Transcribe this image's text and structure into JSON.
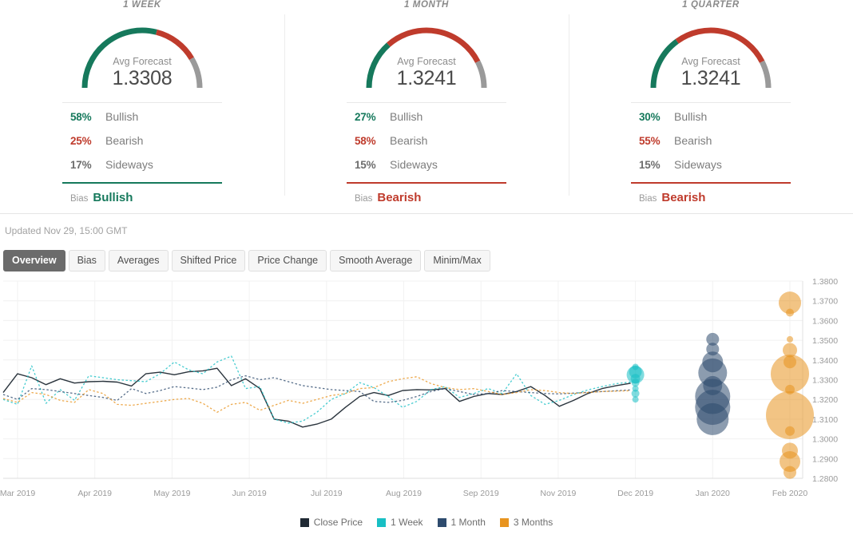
{
  "panels": [
    {
      "title": "1 WEEK",
      "gauge_label": "Avg Forecast",
      "gauge_value": "1.3308",
      "bullish_pct": "58%",
      "bullish_label": "Bullish",
      "bearish_pct": "25%",
      "bearish_label": "Bearish",
      "sideways_pct": "17%",
      "sideways_label": "Sideways",
      "bias_label": "Bias",
      "bias_value": "Bullish",
      "bias_color": "#16795c",
      "arc": {
        "green": 58,
        "red": 25,
        "gray": 17
      }
    },
    {
      "title": "1 MONTH",
      "gauge_label": "Avg Forecast",
      "gauge_value": "1.3241",
      "bullish_pct": "27%",
      "bullish_label": "Bullish",
      "bearish_pct": "58%",
      "bearish_label": "Bearish",
      "sideways_pct": "15%",
      "sideways_label": "Sideways",
      "bias_label": "Bias",
      "bias_value": "Bearish",
      "bias_color": "#bf3b2c",
      "arc": {
        "green": 27,
        "red": 58,
        "gray": 15
      }
    },
    {
      "title": "1 QUARTER",
      "gauge_label": "Avg Forecast",
      "gauge_value": "1.3241",
      "bullish_pct": "30%",
      "bullish_label": "Bullish",
      "bearish_pct": "55%",
      "bearish_label": "Bearish",
      "sideways_pct": "15%",
      "sideways_label": "Sideways",
      "bias_label": "Bias",
      "bias_value": "Bearish",
      "bias_color": "#bf3b2c",
      "arc": {
        "green": 30,
        "red": 55,
        "gray": 15
      }
    }
  ],
  "updated": "Updated Nov 29, 15:00 GMT",
  "tabs": [
    {
      "label": "Overview",
      "active": true
    },
    {
      "label": "Bias",
      "active": false
    },
    {
      "label": "Averages",
      "active": false
    },
    {
      "label": "Shifted Price",
      "active": false
    },
    {
      "label": "Price Change",
      "active": false
    },
    {
      "label": "Smooth Average",
      "active": false
    },
    {
      "label": "Minim/Max",
      "active": false
    }
  ],
  "colors": {
    "bullish": "#16795c",
    "bearish": "#bf3b2c",
    "neutral": "#9a9a9a",
    "close_price": "#1f2933",
    "one_week": "#18bfc4",
    "one_month": "#2e4b6e",
    "three_months": "#e8941f"
  },
  "chart_data": {
    "type": "line",
    "title": "",
    "xlabel": "",
    "ylabel": "",
    "ylim": [
      1.28,
      1.38
    ],
    "grid": true,
    "legend_position": "bottom",
    "y_ticks": [
      "1.3800",
      "1.3700",
      "1.3600",
      "1.3500",
      "1.3400",
      "1.3300",
      "1.3200",
      "1.3100",
      "1.3000",
      "1.2900",
      "1.2800"
    ],
    "x_ticks": [
      "Mar 2019",
      "Apr 2019",
      "May 2019",
      "Jun 2019",
      "Jul 2019",
      "Aug 2019",
      "Sep 2019",
      "Nov 2019",
      "Dec 2019",
      "Jan 2020",
      "Feb 2020"
    ],
    "legend": [
      {
        "name": "Close Price",
        "color": "#1f2933"
      },
      {
        "name": "1 Week",
        "color": "#18bfc4"
      },
      {
        "name": "1 Month",
        "color": "#2e4b6e"
      },
      {
        "name": "3 Months",
        "color": "#e8941f"
      }
    ],
    "series": [
      {
        "name": "Close Price",
        "color": "#1f2933",
        "style": "solid",
        "values": [
          1.3235,
          1.333,
          1.331,
          1.3275,
          1.3305,
          1.3283,
          1.329,
          1.3292,
          1.3288,
          1.3268,
          1.333,
          1.3338,
          1.3325,
          1.334,
          1.3345,
          1.3358,
          1.327,
          1.3305,
          1.3255,
          1.31,
          1.309,
          1.306,
          1.3075,
          1.31,
          1.316,
          1.3215,
          1.3235,
          1.322,
          1.3245,
          1.325,
          1.3248,
          1.3255,
          1.319,
          1.3215,
          1.323,
          1.3225,
          1.324,
          1.3265,
          1.322,
          1.3165,
          1.3195,
          1.323,
          1.3255,
          1.327,
          1.3282
        ]
      },
      {
        "name": "1 Week",
        "color": "#18bfc4",
        "style": "dotted",
        "values": [
          1.32,
          1.3175,
          1.337,
          1.318,
          1.325,
          1.3195,
          1.332,
          1.331,
          1.33,
          1.3295,
          1.329,
          1.333,
          1.339,
          1.335,
          1.333,
          1.339,
          1.342,
          1.3255,
          1.3265,
          1.31,
          1.308,
          1.309,
          1.3135,
          1.32,
          1.323,
          1.3285,
          1.326,
          1.3215,
          1.316,
          1.319,
          1.325,
          1.3265,
          1.321,
          1.323,
          1.3255,
          1.323,
          1.333,
          1.322,
          1.3175,
          1.3195,
          1.3225,
          1.3248,
          1.3265,
          1.328,
          1.3288
        ]
      },
      {
        "name": "1 Month",
        "color": "#2e4b6e",
        "style": "dotted",
        "values": [
          1.3225,
          1.32,
          1.3255,
          1.325,
          1.324,
          1.323,
          1.322,
          1.321,
          1.3195,
          1.3255,
          1.323,
          1.3245,
          1.3265,
          1.3258,
          1.325,
          1.3262,
          1.33,
          1.332,
          1.33,
          1.331,
          1.329,
          1.327,
          1.326,
          1.325,
          1.3245,
          1.324,
          1.319,
          1.3185,
          1.3195,
          1.3215,
          1.324,
          1.3255,
          1.324,
          1.3225,
          1.323,
          1.3245,
          1.324,
          1.3235,
          1.323,
          1.3228,
          1.3232,
          1.3236,
          1.324,
          1.3244,
          1.3248
        ]
      },
      {
        "name": "3 Months",
        "color": "#e8941f",
        "style": "dotted",
        "values": [
          1.3205,
          1.3185,
          1.3235,
          1.3225,
          1.3195,
          1.3185,
          1.325,
          1.323,
          1.3175,
          1.317,
          1.318,
          1.319,
          1.32,
          1.3205,
          1.318,
          1.3135,
          1.3175,
          1.3185,
          1.3145,
          1.317,
          1.3195,
          1.318,
          1.32,
          1.322,
          1.323,
          1.3255,
          1.326,
          1.329,
          1.3305,
          1.3315,
          1.328,
          1.326,
          1.325,
          1.3255,
          1.324,
          1.3225,
          1.3235,
          1.325,
          1.3245,
          1.3235,
          1.323,
          1.3235,
          1.324,
          1.3242,
          1.3244
        ]
      }
    ],
    "forecast_bubbles": [
      {
        "name": "1 Week",
        "color": "#18bfc4",
        "x_label": "Dec 2019",
        "points": [
          {
            "value": 1.3365,
            "size": 4
          },
          {
            "value": 1.334,
            "size": 8
          },
          {
            "value": 1.3325,
            "size": 11
          },
          {
            "value": 1.3305,
            "size": 6
          },
          {
            "value": 1.3285,
            "size": 5
          },
          {
            "value": 1.3255,
            "size": 4
          },
          {
            "value": 1.323,
            "size": 5
          },
          {
            "value": 1.32,
            "size": 4
          }
        ]
      },
      {
        "name": "1 Month",
        "color": "#2e4b6e",
        "x_label": "Jan 2020",
        "points": [
          {
            "value": 1.3505,
            "size": 8
          },
          {
            "value": 1.3455,
            "size": 8
          },
          {
            "value": 1.339,
            "size": 13
          },
          {
            "value": 1.3335,
            "size": 18
          },
          {
            "value": 1.327,
            "size": 12
          },
          {
            "value": 1.3215,
            "size": 22
          },
          {
            "value": 1.316,
            "size": 22
          },
          {
            "value": 1.31,
            "size": 20
          }
        ]
      },
      {
        "name": "3 Months",
        "color": "#e8941f",
        "x_label": "Feb 2020",
        "points": [
          {
            "value": 1.369,
            "size": 14
          },
          {
            "value": 1.364,
            "size": 5
          },
          {
            "value": 1.3505,
            "size": 4
          },
          {
            "value": 1.345,
            "size": 9
          },
          {
            "value": 1.339,
            "size": 8
          },
          {
            "value": 1.333,
            "size": 24
          },
          {
            "value": 1.325,
            "size": 6
          },
          {
            "value": 1.312,
            "size": 30
          },
          {
            "value": 1.304,
            "size": 6
          },
          {
            "value": 1.294,
            "size": 10
          },
          {
            "value": 1.2885,
            "size": 13
          },
          {
            "value": 1.283,
            "size": 8
          }
        ]
      }
    ]
  }
}
